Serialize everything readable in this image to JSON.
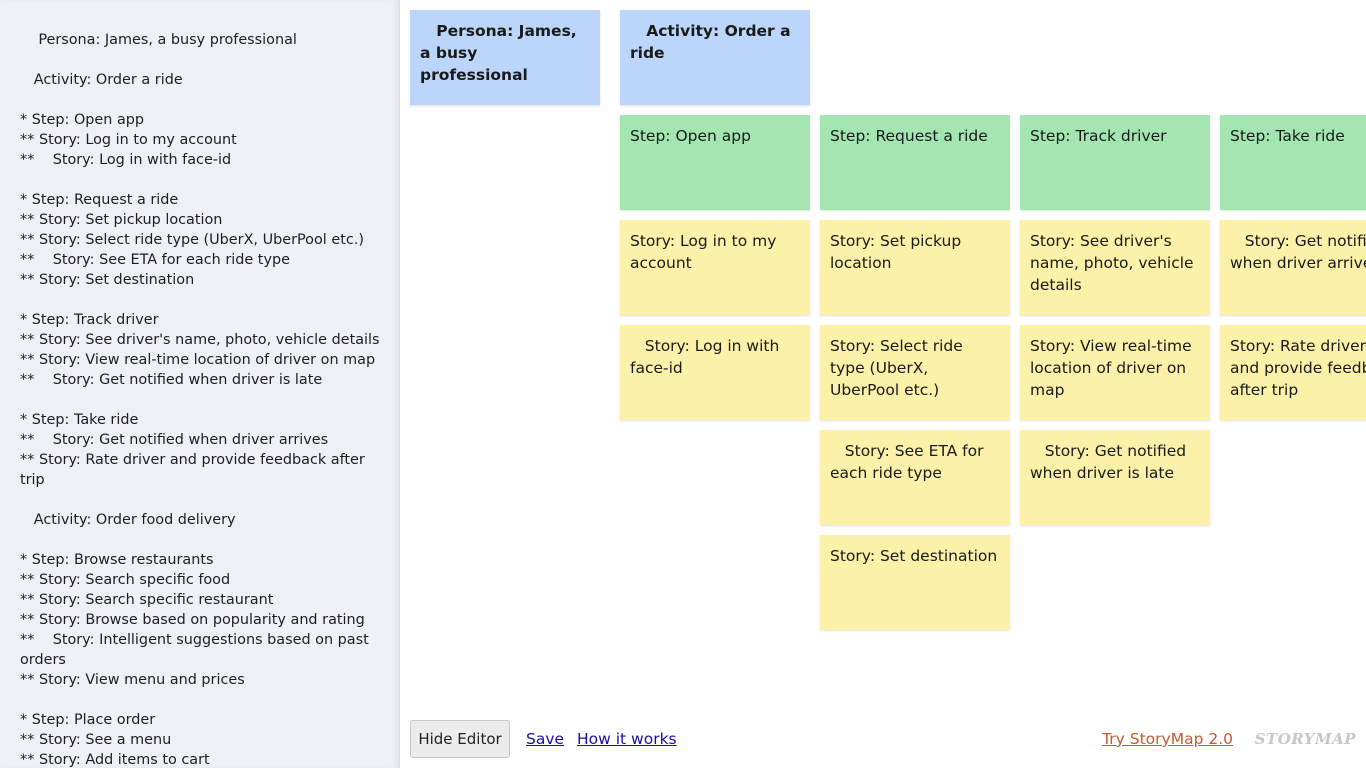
{
  "editor": {
    "lines": [
      "    Persona: James, a busy professional",
      "",
      "   Activity: Order a ride",
      "",
      "* Step: Open app",
      "** Story: Log in to my account",
      "**    Story: Log in with face-id",
      "",
      "* Step: Request a ride",
      "** Story: Set pickup location",
      "** Story: Select ride type (UberX, UberPool etc.)",
      "**    Story: See ETA for each ride type",
      "** Story: Set destination",
      "",
      "* Step: Track driver",
      "** Story: See driver's name, photo, vehicle details",
      "** Story: View real-time location of driver on map",
      "**    Story: Get notified when driver is late",
      "",
      "* Step: Take ride",
      "**    Story: Get notified when driver arrives",
      "** Story: Rate driver and provide feedback after trip",
      "",
      "   Activity: Order food delivery",
      "",
      "* Step: Browse restaurants",
      "** Story: Search specific food",
      "** Story: Search specific restaurant",
      "** Story: Browse based on popularity and rating",
      "**    Story: Intelligent suggestions based on past orders",
      "** Story: View menu and prices",
      "",
      "* Step: Place order",
      "** Story: See a menu",
      "** Story: Add items to cart"
    ]
  },
  "board": {
    "persona": "   Persona: James, a busy professional",
    "activity": "   Activity: Order a ride",
    "steps": [
      {
        "title": "Step: Open app",
        "stories": [
          "Story: Log in to my account",
          "   Story: Log in with face-id"
        ]
      },
      {
        "title": "Step: Request a ride",
        "stories": [
          "Story: Set pickup location",
          "Story: Select ride type (UberX, UberPool etc.)",
          "   Story: See ETA for each ride type",
          "Story: Set destination"
        ]
      },
      {
        "title": "Step: Track driver",
        "stories": [
          "Story: See driver's name, photo, vehicle details",
          "Story: View real-time location of driver on map",
          "   Story: Get notified when driver is late"
        ]
      },
      {
        "title": "Step: Take ride",
        "stories": [
          "   Story: Get notified when driver arrives",
          "Story: Rate driver and provide feedback after trip"
        ]
      }
    ]
  },
  "footer": {
    "hide_editor": "Hide Editor",
    "save": "Save",
    "how_it_works": "How it works",
    "try_storymap": "Try StoryMap 2.0",
    "logo_text": "STORYMAP"
  },
  "colors": {
    "persona": "#bcd6fb",
    "activity": "#bcd6fb",
    "step": "#a4e6b2",
    "story": "#fbf1a9",
    "link": "#1a0dab",
    "promo_link": "#c75a2a"
  }
}
